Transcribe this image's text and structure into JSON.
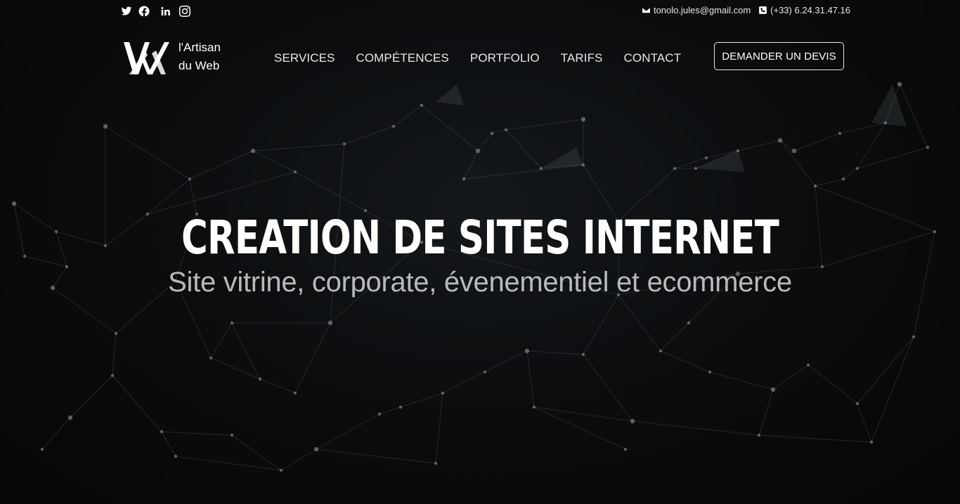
{
  "topbar": {
    "social": [
      {
        "icon": "twitter-icon"
      },
      {
        "icon": "facebook-icon"
      },
      {
        "icon": "linkedin-icon"
      },
      {
        "icon": "instagram-icon"
      }
    ],
    "email": "tonolo.jules@gmail.com",
    "phone": "(+33) 6.24.31.47.16"
  },
  "logo": {
    "line1": "l'Artisan",
    "line2": "du Web"
  },
  "nav": {
    "items": [
      "SERVICES",
      "COMPÉTENCES",
      "PORTFOLIO",
      "TARIFS",
      "CONTACT"
    ]
  },
  "cta": {
    "label": "DEMANDER UN DEVIS"
  },
  "hero": {
    "title": "CREATION DE SITES INTERNET",
    "subtitle": "Site vitrine, corporate, évenementiel et ecommerce"
  },
  "colors": {
    "background": "#050607",
    "text": "#ffffff",
    "subtitle": "#b8babc"
  }
}
